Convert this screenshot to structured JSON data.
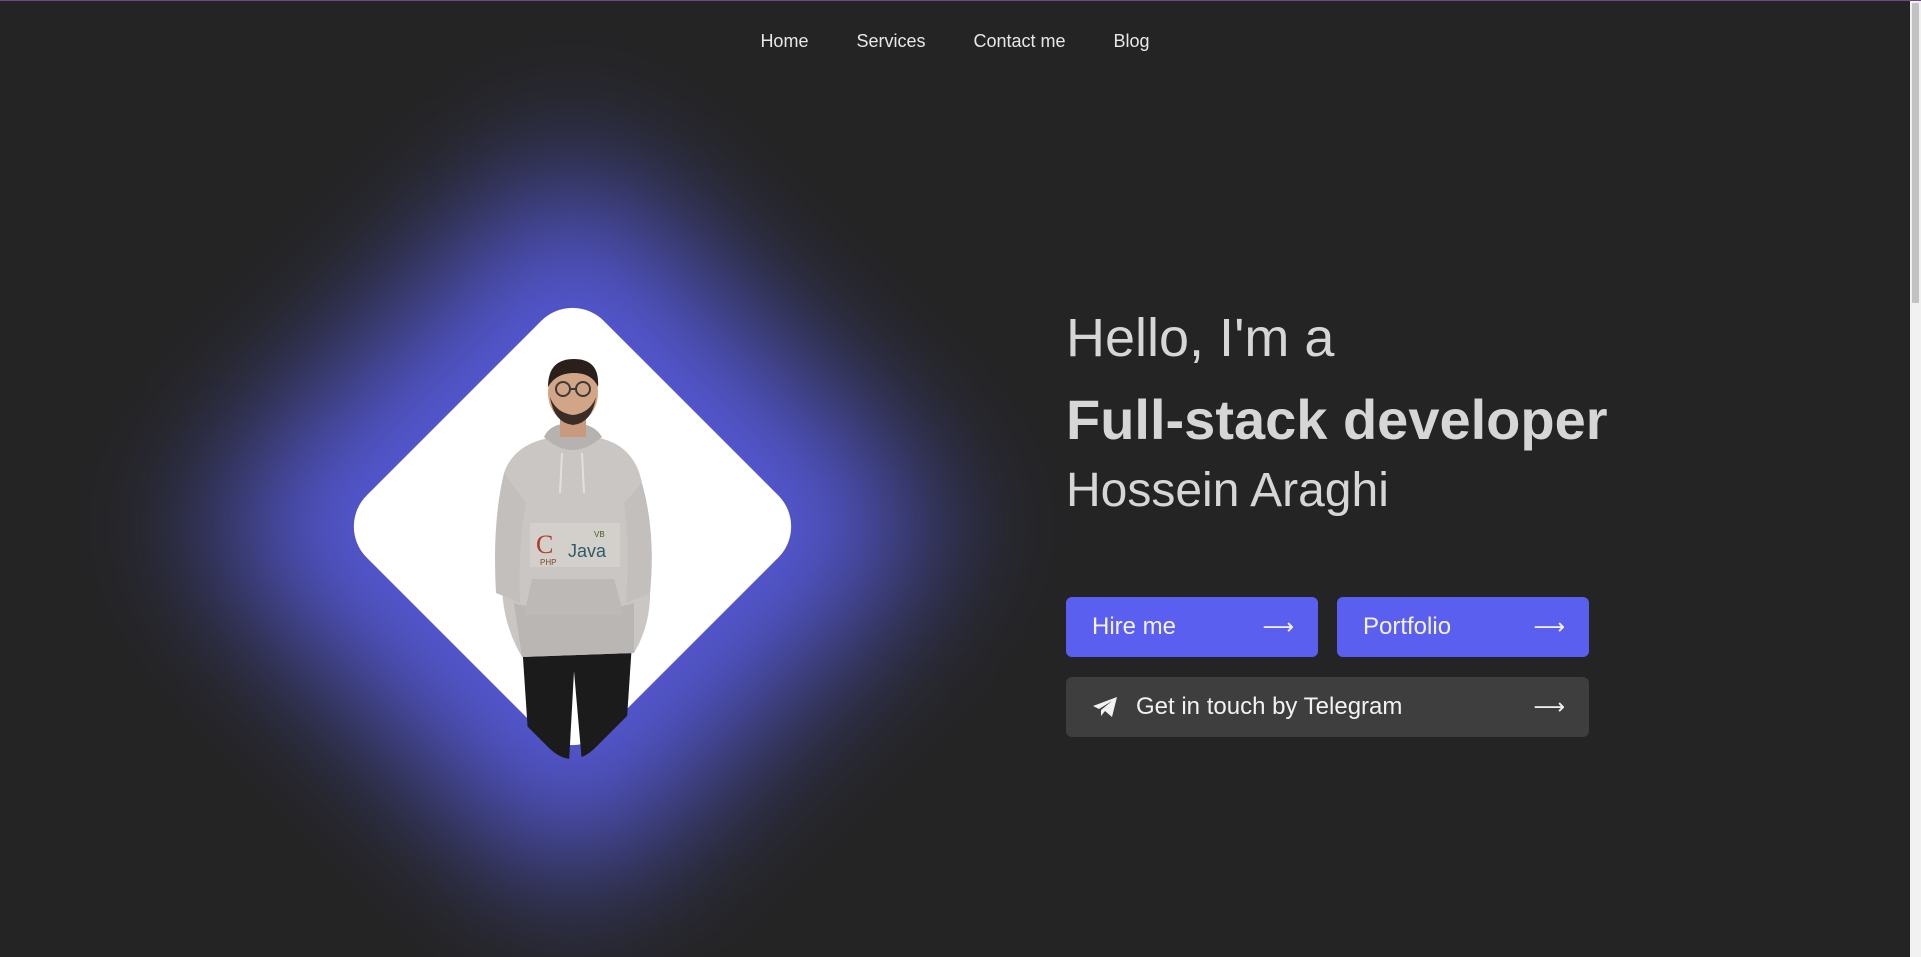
{
  "nav": {
    "items": [
      "Home",
      "Services",
      "Contact me",
      "Blog"
    ]
  },
  "hero": {
    "greeting": "Hello, I'm a",
    "role": "Full-stack developer",
    "name": "Hossein Araghi",
    "hoodie_text": {
      "letter": "C",
      "word": "Java",
      "small_1": "PHP",
      "small_2": "VB"
    }
  },
  "buttons": {
    "hire": {
      "label": "Hire me",
      "arrow": "⟶"
    },
    "portfolio": {
      "label": "Portfolio",
      "arrow": "⟶"
    },
    "telegram": {
      "label": "Get in touch by Telegram",
      "arrow": "⟶",
      "icon": "paper-plane-icon"
    }
  },
  "colors": {
    "background": "#242424",
    "accent": "#5b5ff0",
    "secondary_button": "#3e3e3e",
    "text": "#d6d6d6"
  }
}
